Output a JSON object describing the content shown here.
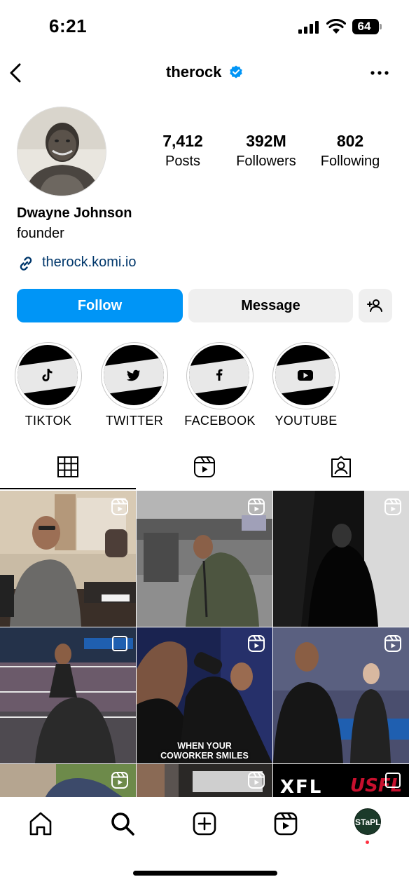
{
  "status_bar": {
    "time": "6:21",
    "battery": "64"
  },
  "header": {
    "username": "therock"
  },
  "profile": {
    "stats": [
      {
        "value": "7,412",
        "label": "Posts"
      },
      {
        "value": "392M",
        "label": "Followers"
      },
      {
        "value": "802",
        "label": "Following"
      }
    ],
    "full_name": "Dwayne Johnson",
    "bio": "founder",
    "link": "therock.komi.io"
  },
  "actions": {
    "follow": "Follow",
    "message": "Message"
  },
  "highlights": [
    {
      "label": "TIKTOK",
      "icon": "tiktok-icon"
    },
    {
      "label": "TWITTER",
      "icon": "twitter-icon"
    },
    {
      "label": "FACEBOOK",
      "icon": "facebook-icon"
    },
    {
      "label": "YOUTUBE",
      "icon": "youtube-icon"
    }
  ],
  "tabs": [
    "grid-icon",
    "reels-icon",
    "tagged-icon"
  ],
  "grid": {
    "captions": {
      "coworker": "WHEN YOUR\nCOWORKER SMILES",
      "xfl": "XFL",
      "usfl": "USFL"
    }
  },
  "bottom_nav": {
    "profile_initials": "STaPL"
  },
  "colors": {
    "accent": "#0095f6",
    "verified": "#0095f6",
    "link": "#00376b"
  }
}
